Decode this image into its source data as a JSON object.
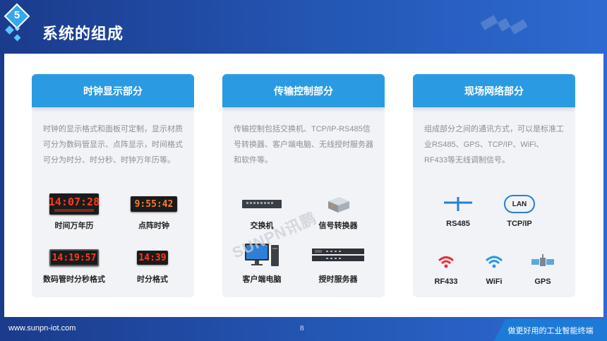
{
  "header": {
    "section_number": "5",
    "title": "系统的组成"
  },
  "cards": [
    {
      "title": "时钟显示部分",
      "description": "时钟的显示格式和面板可定制，显示材质可分为数码管显示、点阵显示，时间格式可分为时分、时分秒、时钟万年历等。",
      "items": [
        {
          "label": "时间万年历",
          "display": "14:07:28"
        },
        {
          "label": "点阵时钟",
          "display": "9:55:42"
        },
        {
          "label": "数码管时分秒格式",
          "display": "14:19:57"
        },
        {
          "label": "时分格式",
          "display": "14:39"
        }
      ]
    },
    {
      "title": "传输控制部分",
      "description": "传输控制包括交换机、TCP/IP-RS485信号转换器、客户端电脑、无线授时服务器和软件等。",
      "items": [
        {
          "label": "交换机"
        },
        {
          "label": "信号转换器"
        },
        {
          "label": "客户端电脑"
        },
        {
          "label": "授时服务器"
        }
      ]
    },
    {
      "title": "现场网络部分",
      "description": "组成部分之间的通讯方式，可以是标准工业RS485、GPS、TCP/IP、WiFi、RF433等无线调制信号。",
      "items": [
        {
          "label": "RS485"
        },
        {
          "label": "TCP/IP",
          "badge": "LAN"
        },
        {
          "label": "RF433"
        },
        {
          "label": "WiFi"
        },
        {
          "label": "GPS"
        }
      ]
    }
  ],
  "watermark": "SUNPN讯鹏",
  "footer": {
    "url": "www.sunpn-iot.com",
    "page": "8",
    "slogan": "做更好用的工业智能终端"
  },
  "colors": {
    "header_bg": "#2457b5",
    "card_head": "#2a9be3",
    "led_red": "#ff3b1f",
    "accent": "#36a9ee"
  }
}
